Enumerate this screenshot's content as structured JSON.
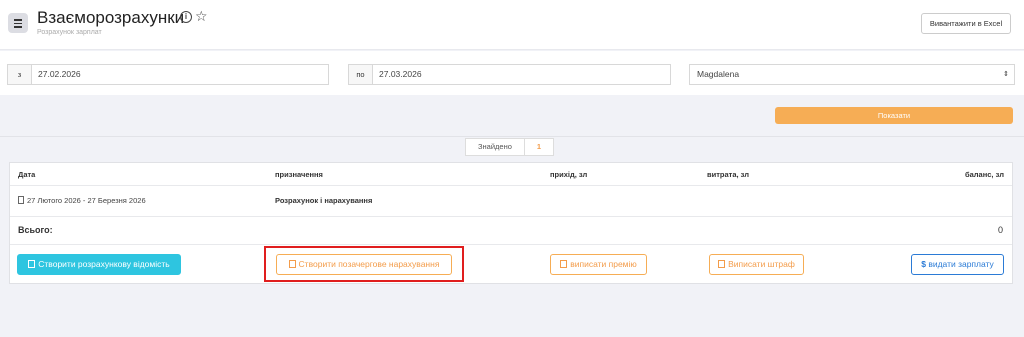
{
  "header": {
    "title": "Взаєморозрахунки",
    "subtitle": "Розрахунок зарплат",
    "excel_button": "Вивантажити в Excel",
    "info_icon": "i",
    "star_icon": "☆"
  },
  "filters": {
    "from_label": "з",
    "from_value": "27.02.2026",
    "to_label": "по",
    "to_value": "27.03.2026",
    "employee_selected": "Magdalena",
    "select_arrows": "⇕",
    "show_button": "Показати"
  },
  "found": {
    "label": "Знайдено",
    "count": "1"
  },
  "table": {
    "columns": {
      "date": "Дата",
      "purpose": "призначення",
      "income": "прихід, зл",
      "expense": "витрата, зл",
      "balance": "баланс, зл"
    },
    "rows": [
      {
        "date": "27 Лютого 2026 - 27 Березня 2026",
        "purpose": "Розрахунок і нарахування",
        "income": "",
        "expense": "",
        "balance": ""
      }
    ],
    "total_label": "Всього:",
    "total_value": "0"
  },
  "actions": {
    "create_statement": "Створити розрахункову відомість",
    "create_extra_accrual": "Створити позачергове нарахування",
    "issue_bonus": "виписати премію",
    "issue_fine": "Виписати штраф",
    "pay_salary": "видати зарплату"
  },
  "colors": {
    "accent_orange": "#f6ad55",
    "cyan": "#2ec5e0",
    "blue": "#2b7bd6",
    "highlight_red": "#e01e1e"
  }
}
